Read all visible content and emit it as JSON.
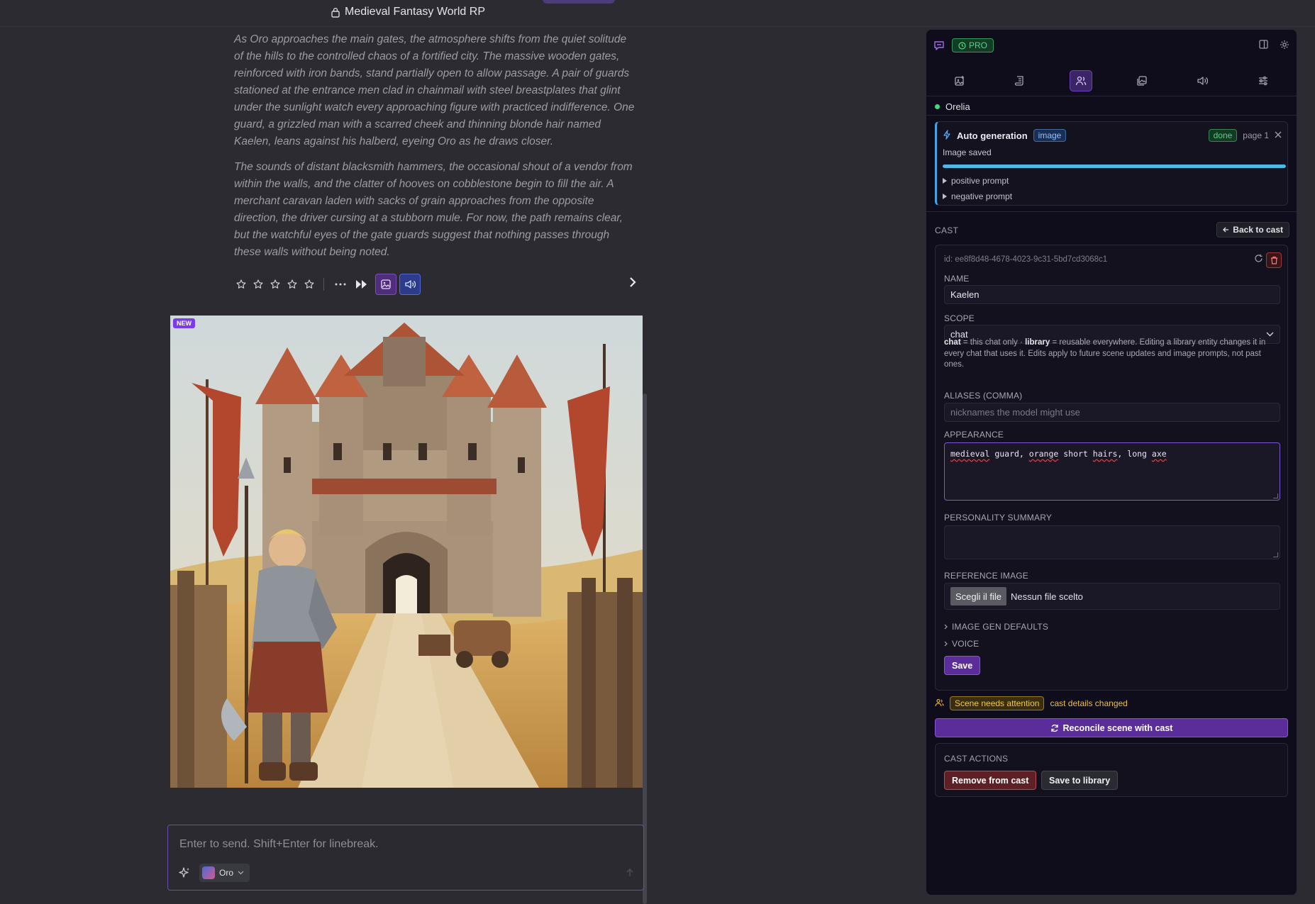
{
  "chat": {
    "title": "Medieval Fantasy World RP",
    "message_paragraphs": [
      "As Oro approaches the main gates, the atmosphere shifts from the quiet solitude of the hills to the controlled chaos of a fortified city. The massive wooden gates, reinforced with iron bands, stand partially open to allow passage. A pair of guards stationed at the entrance men clad in chainmail with steel breastplates that glint under the sunlight watch every approaching figure with practiced indifference. One guard, a grizzled man with a scarred cheek and thinning blonde hair named Kaelen, leans against his halberd, eyeing Oro as he draws closer.",
      "The sounds of distant blacksmith hammers, the occasional shout of a vendor from within the walls, and the clatter of hooves on cobblestone begin to fill the air. A merchant caravan laden with sacks of grain approaches from the opposite direction, the driver cursing at a stubborn mule. For now, the path remains clear, but the watchful eyes of the gate guards suggest that nothing passes through these walls without being noted."
    ],
    "rating_stars": 5,
    "toolbar_icons": [
      "star-icon",
      "more-icon",
      "fast-forward-icon",
      "image-icon",
      "speaker-icon",
      "chevron-right-icon"
    ],
    "image_badge": "NEW",
    "composer": {
      "placeholder": "Enter to send. Shift+Enter for linebreak.",
      "character": "Oro"
    }
  },
  "panel": {
    "pro_label": "PRO",
    "tabs": [
      "image-edit-icon",
      "scroll-icon",
      "users-icon",
      "gallery-icon",
      "speaker-icon",
      "sliders-icon"
    ],
    "active_tab": 2,
    "character_name": "Orelia",
    "autogen": {
      "title": "Auto generation",
      "type": "image",
      "status": "done",
      "page": "page 1",
      "message": "Image saved",
      "progress": 1.0,
      "positive_prompt": "positive prompt",
      "negative_prompt": "negative prompt"
    },
    "cast": {
      "label": "CAST",
      "back_label": "Back to cast",
      "id_text": "id: ee8f8d48-4678-4023-9c31-5bd7cd3068c1",
      "name_label": "NAME",
      "name_value": "Kaelen",
      "scope_label": "SCOPE",
      "scope_value": "chat",
      "scope_help": {
        "chat": "chat",
        "chat_desc": " = this chat only · ",
        "library": "library",
        "library_desc": " = reusable everywhere. Editing a library entity changes it in every chat that uses it. Edits apply to future scene updates and image prompts, not past ones."
      },
      "aliases_label": "ALIASES (COMMA)",
      "aliases_placeholder": "nicknames the model might use",
      "appearance_label": "APPEARANCE",
      "appearance_words": [
        "medieval",
        " guard, ",
        "orange",
        " short ",
        "hairs",
        ", long ",
        "axe"
      ],
      "personality_label": "PERSONALITY SUMMARY",
      "reference_label": "REFERENCE IMAGE",
      "file_button": "Scegli il file",
      "file_status": "Nessun file scelto",
      "image_gen_defaults": "IMAGE GEN DEFAULTS",
      "voice": "VOICE",
      "save": "Save"
    },
    "attention": {
      "badge": "Scene needs attention",
      "text": "cast details changed"
    },
    "reconcile": "Reconcile scene with cast",
    "cast_actions": {
      "label": "CAST ACTIONS",
      "remove": "Remove from cast",
      "save_library": "Save to library"
    }
  },
  "colors": {
    "accent_purple": "#5b2d9b",
    "progress": "#4fb9e6",
    "success": "#56d38a",
    "warning": "#f2c84a",
    "danger": "#b84a52"
  }
}
